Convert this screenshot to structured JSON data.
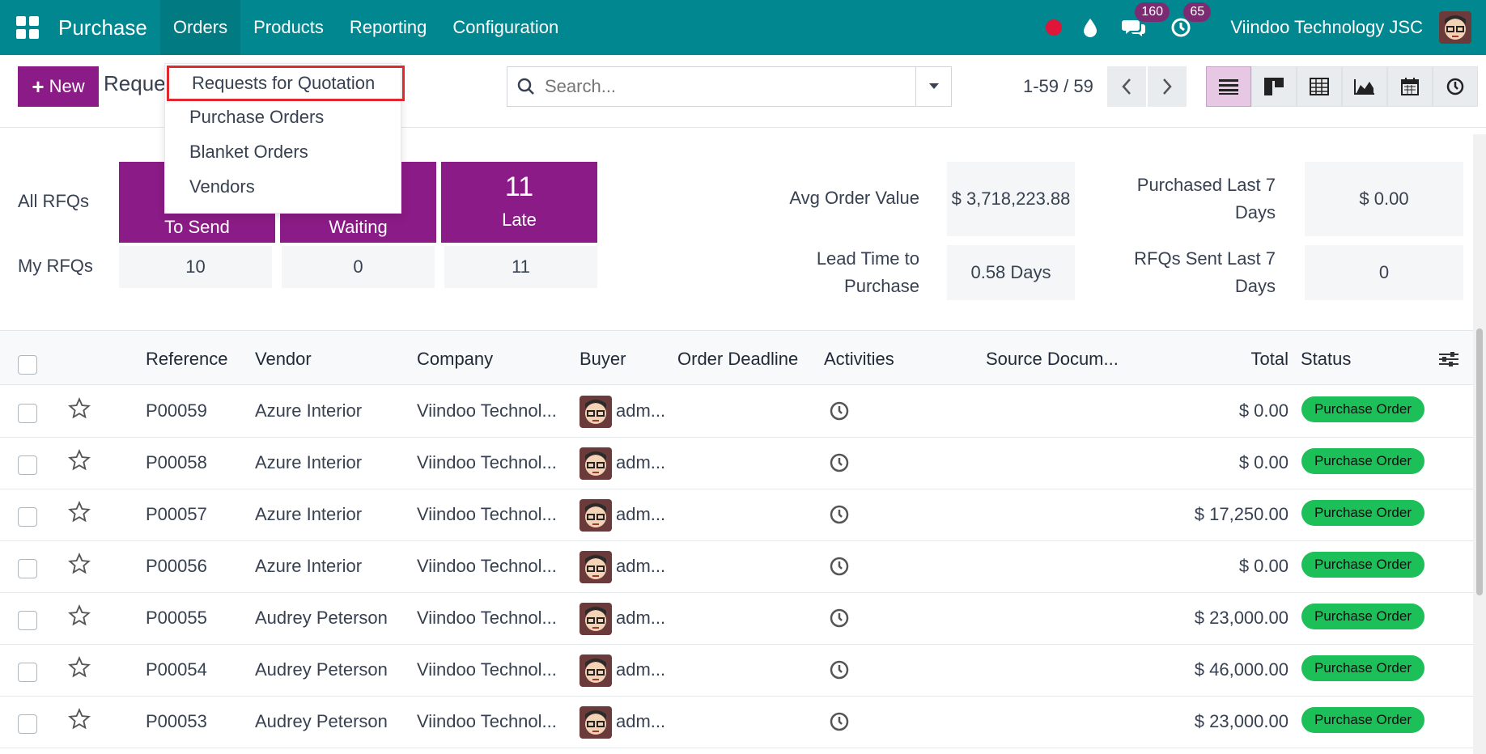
{
  "navbar": {
    "app_name": "Purchase",
    "menu": [
      "Orders",
      "Products",
      "Reporting",
      "Configuration"
    ],
    "chat_count": "160",
    "activity_count": "65",
    "company": "Viindoo Technology JSC"
  },
  "control": {
    "new_label": "New",
    "breadcrumb": "Reque",
    "search_placeholder": "Search...",
    "pager": "1-59 / 59"
  },
  "dropdown": {
    "items": [
      "Requests for Quotation",
      "Purchase Orders",
      "Blanket Orders",
      "Vendors"
    ]
  },
  "dashboard": {
    "all_rfqs_label": "All RFQs",
    "my_rfqs_label": "My RFQs",
    "tiles": [
      {
        "number": "",
        "label": "To Send"
      },
      {
        "number": "",
        "label": "Waiting"
      },
      {
        "number": "11",
        "label": "Late"
      }
    ],
    "my_values": [
      "10",
      "0",
      "11"
    ],
    "kpis": {
      "avg_order_value_label": "Avg Order Value",
      "avg_order_value": "$ 3,718,223.88",
      "lead_time_label_1": "Lead Time to",
      "lead_time_label_2": "Purchase",
      "lead_time": "0.58 Days",
      "purchased_label_1": "Purchased Last 7",
      "purchased_label_2": "Days",
      "purchased": "$ 0.00",
      "rfqs_sent_label_1": "RFQs Sent Last 7",
      "rfqs_sent_label_2": "Days",
      "rfqs_sent": "0"
    }
  },
  "table": {
    "headers": [
      "Reference",
      "Vendor",
      "Company",
      "Buyer",
      "Order Deadline",
      "Activities",
      "Source Docum...",
      "Total",
      "Status"
    ],
    "rows": [
      {
        "ref": "P00059",
        "vendor": "Azure Interior",
        "company": "Viindoo Technol...",
        "buyer": "adm...",
        "total": "$ 0.00",
        "status": "Purchase Order"
      },
      {
        "ref": "P00058",
        "vendor": "Azure Interior",
        "company": "Viindoo Technol...",
        "buyer": "adm...",
        "total": "$ 0.00",
        "status": "Purchase Order"
      },
      {
        "ref": "P00057",
        "vendor": "Azure Interior",
        "company": "Viindoo Technol...",
        "buyer": "adm...",
        "total": "$ 17,250.00",
        "status": "Purchase Order"
      },
      {
        "ref": "P00056",
        "vendor": "Azure Interior",
        "company": "Viindoo Technol...",
        "buyer": "adm...",
        "total": "$ 0.00",
        "status": "Purchase Order"
      },
      {
        "ref": "P00055",
        "vendor": "Audrey Peterson",
        "company": "Viindoo Technol...",
        "buyer": "adm...",
        "total": "$ 23,000.00",
        "status": "Purchase Order"
      },
      {
        "ref": "P00054",
        "vendor": "Audrey Peterson",
        "company": "Viindoo Technol...",
        "buyer": "adm...",
        "total": "$ 46,000.00",
        "status": "Purchase Order"
      },
      {
        "ref": "P00053",
        "vendor": "Audrey Peterson",
        "company": "Viindoo Technol...",
        "buyer": "adm...",
        "total": "$ 23,000.00",
        "status": "Purchase Order"
      }
    ]
  },
  "colors": {
    "navbar": "#00878f",
    "primary": "#8b1b86",
    "status_green": "#1dbf59",
    "highlight_red": "#e0282e"
  }
}
